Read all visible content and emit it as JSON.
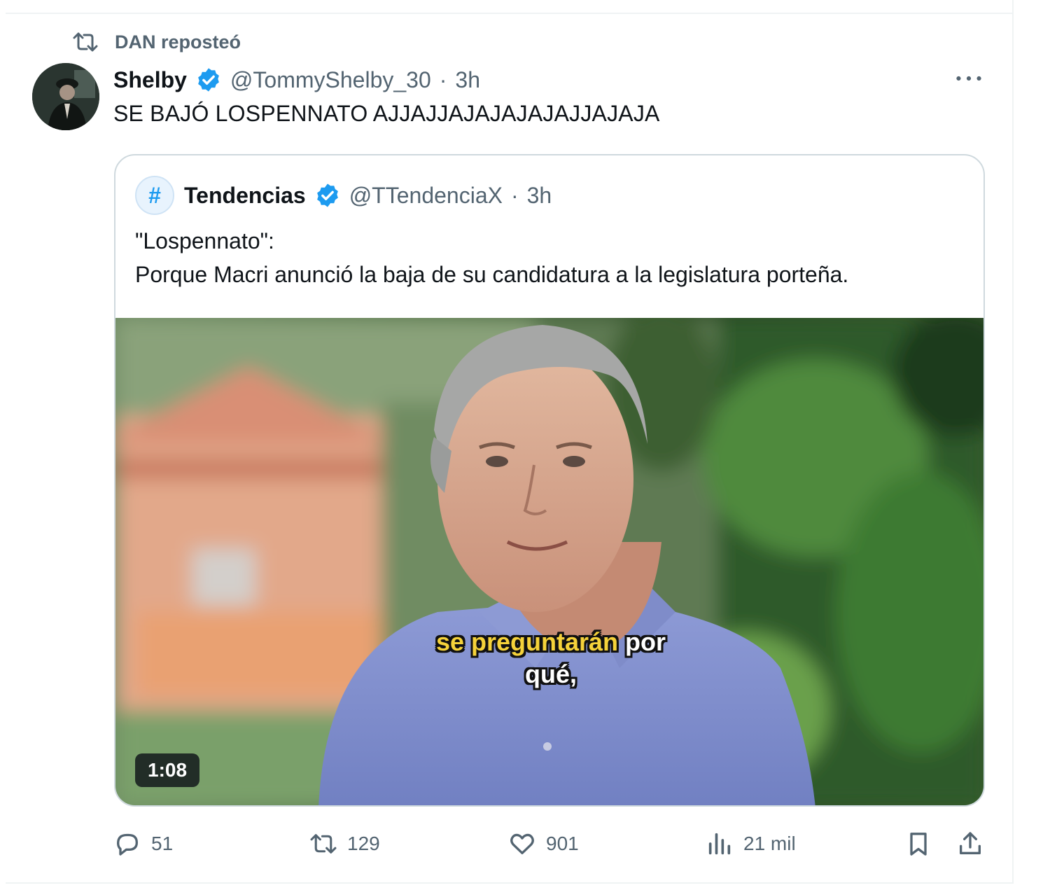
{
  "repost": {
    "label": "DAN reposteó"
  },
  "tweet": {
    "display_name": "Shelby",
    "handle": "@TommyShelby_30",
    "separator": "·",
    "time": "3h",
    "text": "SE BAJÓ LOSPENNATO AJJAJJAJAJAJAJAJJAJAJA"
  },
  "quote": {
    "avatar_glyph": "#",
    "display_name": "Tendencias",
    "handle": "@TTendenciaX",
    "separator": "·",
    "time": "3h",
    "line1": "\"Lospennato\":",
    "line2": "Porque Macri anunció la baja de su candidatura a la legislatura porteña.",
    "media": {
      "caption_part1": "se preguntarán",
      "caption_part2": " por",
      "caption_line2": "qué,",
      "duration": "1:08"
    }
  },
  "actions": {
    "replies": "51",
    "reposts": "129",
    "likes": "901",
    "views": "21 mil"
  },
  "colors": {
    "accent": "#1d9bf0",
    "secondary_text": "#536471",
    "primary_text": "#0f1419",
    "caption_highlight": "#f5d23a"
  },
  "icons": [
    "repost-icon",
    "verified-badge-icon",
    "more-icon",
    "reply-icon",
    "like-icon",
    "views-icon",
    "bookmark-icon",
    "share-icon"
  ]
}
